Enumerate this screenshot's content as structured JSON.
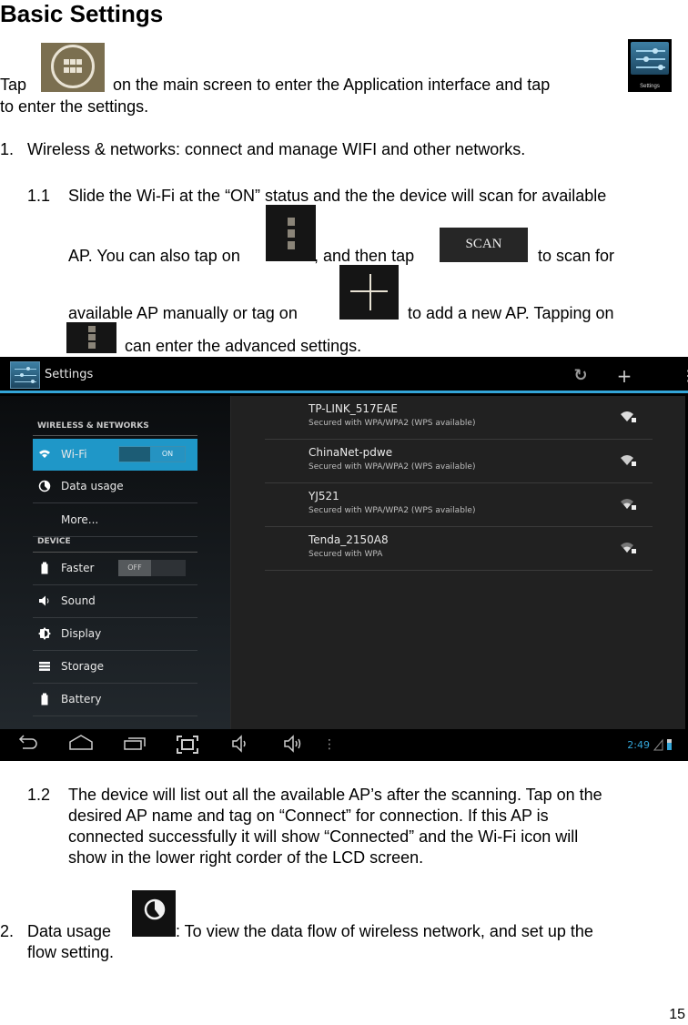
{
  "title": "Basic Settings",
  "intro": {
    "part1": "Tap",
    "part2": "on the main screen to enter the Application interface and tap",
    "part3": "to enter the settings.",
    "settings_icon_caption": "Settings"
  },
  "section1": {
    "number": "1.",
    "text": "Wireless & networks: connect and manage WIFI and other networks."
  },
  "section1_1": {
    "number": "1.1",
    "line1": "Slide the Wi-Fi at the “ON” status and the the device will scan for available",
    "line2a": "AP. You can also tap on",
    "line2b": ", and then tap",
    "line2c": "to scan for",
    "scan_label": "SCAN",
    "line3a": "available AP manually or tag on",
    "line3b": "to add a new AP. Tapping on",
    "line4": "can enter the advanced settings."
  },
  "screenshot": {
    "actionbar": {
      "title": "Settings",
      "icons": [
        "wps-icon",
        "add-icon",
        "overflow-menu-icon"
      ]
    },
    "sidebar": {
      "sections": [
        {
          "header": "WIRELESS & NETWORKS",
          "items": [
            {
              "label": "Wi-Fi",
              "icon": "wifi-icon",
              "toggle": "ON",
              "selected": true
            },
            {
              "label": "Data usage",
              "icon": "data-usage-icon"
            },
            {
              "label": "More...",
              "icon": ""
            }
          ]
        },
        {
          "header": "DEVICE",
          "items": [
            {
              "label": "Faster",
              "icon": "battery-icon",
              "toggle": "OFF"
            },
            {
              "label": "Sound",
              "icon": "sound-icon"
            },
            {
              "label": "Display",
              "icon": "display-icon"
            },
            {
              "label": "Storage",
              "icon": "storage-icon"
            },
            {
              "label": "Battery",
              "icon": "battery-icon"
            }
          ]
        }
      ]
    },
    "access_points": [
      {
        "name": "TP-LINK_517EAE",
        "security": "Secured with WPA/WPA2 (WPS available)"
      },
      {
        "name": "ChinaNet-pdwe",
        "security": "Secured with WPA/WPA2 (WPS available)"
      },
      {
        "name": "YJ521",
        "security": "Secured with WPA/WPA2 (WPS available)"
      },
      {
        "name": "Tenda_2150A8",
        "security": "Secured with WPA"
      }
    ],
    "navbar": {
      "buttons": [
        "back-icon",
        "home-icon",
        "recent-apps-icon",
        "screenshot-icon",
        "volume-down-icon",
        "volume-up-icon",
        "menu-icon"
      ],
      "clock": "2:49"
    },
    "accent_color": "#33a5d8"
  },
  "section1_2": {
    "number": "1.2",
    "lines": [
      "The device will list out all the available AP’s after the scanning. Tap on the",
      "desired AP name and tag on “Connect” for connection. If this AP is",
      "connected successfully it will show “Connected” and the Wi-Fi icon will",
      "show in the lower right corder of the LCD screen."
    ]
  },
  "section2": {
    "number": "2.",
    "label": "Data usage",
    "text": ": To view the data flow of wireless network, and set up the",
    "line2": "flow setting."
  },
  "page_number": "15"
}
